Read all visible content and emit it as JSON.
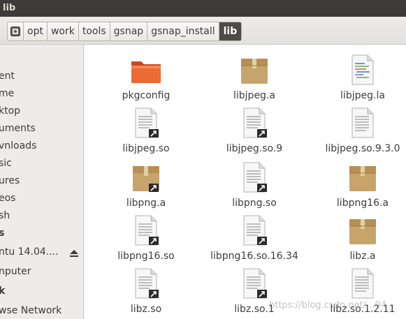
{
  "window": {
    "title": "lib"
  },
  "pathbar": {
    "home_icon": "drive-icon",
    "crumbs": [
      "opt",
      "work",
      "tools",
      "gsnap",
      "gsnap_install",
      "lib"
    ]
  },
  "sidebar": {
    "items": [
      {
        "label": "ent"
      },
      {
        "label": "me"
      },
      {
        "label": "ktop"
      },
      {
        "label": "uments"
      },
      {
        "label": "vnloads"
      },
      {
        "label": "sic"
      },
      {
        "label": "ures"
      },
      {
        "label": "eos"
      },
      {
        "label": "sh"
      },
      {
        "label": "s"
      },
      {
        "label": "ntu 14.04...."
      },
      {
        "label": "nputer"
      },
      {
        "label": "k"
      },
      {
        "label": "wse Network"
      }
    ]
  },
  "files": [
    {
      "name": "pkgconfig",
      "type": "folder"
    },
    {
      "name": "libjpeg.a",
      "type": "archive"
    },
    {
      "name": "libjpeg.la",
      "type": "script"
    },
    {
      "name": "libjpeg.so",
      "type": "text-link"
    },
    {
      "name": "libjpeg.so.9",
      "type": "text-link"
    },
    {
      "name": "libjpeg.so.9.3.0",
      "type": "text"
    },
    {
      "name": "libpng.a",
      "type": "archive-link"
    },
    {
      "name": "libpng.so",
      "type": "text-link"
    },
    {
      "name": "libpng16.a",
      "type": "archive"
    },
    {
      "name": "libpng16.so",
      "type": "text-link"
    },
    {
      "name": "libpng16.so.16.34",
      "type": "text-link"
    },
    {
      "name": "libz.a",
      "type": "archive"
    },
    {
      "name": "libz.so",
      "type": "text-link"
    },
    {
      "name": "libz.so.1",
      "type": "text-link"
    },
    {
      "name": "libz.so.1.2.11",
      "type": "text"
    }
  ],
  "watermark": "https://blog.csdn.net/...94",
  "colors": {
    "folder": "#e9592a",
    "archive": "#c9a76e",
    "active_crumb": "#4c4b47",
    "titlebar": "#3c3b37"
  }
}
